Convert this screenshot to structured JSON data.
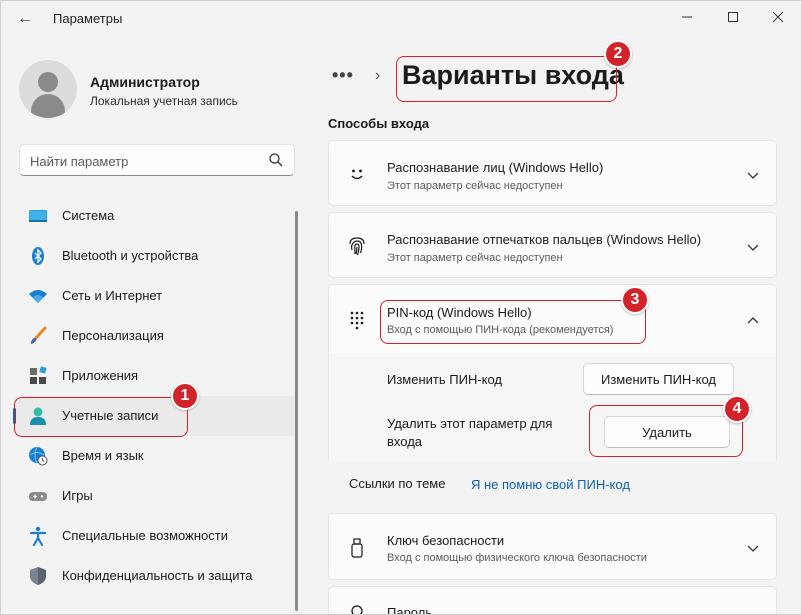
{
  "window": {
    "title": "Параметры",
    "back_icon": "←",
    "minimize": "—",
    "maximize": "☐",
    "close": "✕"
  },
  "user": {
    "name": "Администратор",
    "account_type": "Локальная учетная запись"
  },
  "search": {
    "placeholder": "Найти параметр"
  },
  "sidebar": {
    "items": [
      {
        "label": "Система",
        "icon": "system-icon"
      },
      {
        "label": "Bluetooth и устройства",
        "icon": "bluetooth-icon"
      },
      {
        "label": "Сеть и Интернет",
        "icon": "wifi-icon"
      },
      {
        "label": "Персонализация",
        "icon": "brush-icon"
      },
      {
        "label": "Приложения",
        "icon": "apps-icon"
      },
      {
        "label": "Учетные записи",
        "icon": "accounts-icon",
        "active": true
      },
      {
        "label": "Время и язык",
        "icon": "time-language-icon"
      },
      {
        "label": "Игры",
        "icon": "gamepad-icon"
      },
      {
        "label": "Специальные возможности",
        "icon": "accessibility-icon"
      },
      {
        "label": "Конфиденциальность и защита",
        "icon": "shield-icon"
      }
    ]
  },
  "breadcrumb": {
    "dots": "•••",
    "separator": "›",
    "title": "Варианты входа"
  },
  "section": {
    "title": "Способы входа"
  },
  "options": {
    "face": {
      "title": "Распознавание лиц (Windows Hello)",
      "subtitle": "Этот параметр сейчас недоступен"
    },
    "fingerprint": {
      "title": "Распознавание отпечатков пальцев (Windows Hello)",
      "subtitle": "Этот параметр сейчас недоступен"
    },
    "pin": {
      "title": "PIN-код (Windows Hello)",
      "subtitle": "Вход с помощью ПИН-кода (рекомендуется)",
      "change_label": "Изменить ПИН-код",
      "change_button": "Изменить ПИН-код",
      "remove_label_line1": "Удалить этот параметр для",
      "remove_label_line2": "входа",
      "remove_button": "Удалить",
      "links_label": "Ссылки по теме",
      "forgot_link": "Я не помню свой ПИН-код"
    },
    "security_key": {
      "title": "Ключ безопасности",
      "subtitle": "Вход с помощью физического ключа безопасности"
    },
    "password": {
      "title": "Пароль"
    }
  },
  "annotations": {
    "badge1": "1",
    "badge2": "2",
    "badge3": "3",
    "badge4": "4"
  },
  "colors": {
    "accent": "#0067c0",
    "annotation": "#d3232a",
    "link": "#0f5fb8"
  }
}
